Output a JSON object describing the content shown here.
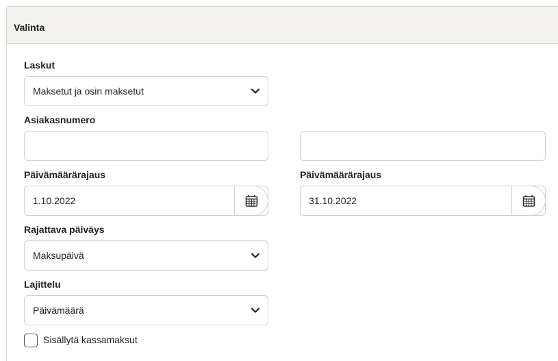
{
  "panel": {
    "title": "Valinta"
  },
  "invoices": {
    "label": "Laskut",
    "selected": "Maksetut ja osin maksetut",
    "icon": "chevron-down-icon"
  },
  "customer": {
    "label": "Asiakasnumero",
    "from_value": "",
    "to_value": ""
  },
  "date_from": {
    "label": "Päivämäärärajaus",
    "value": "1.10.2022",
    "icon": "calendar-icon"
  },
  "date_to": {
    "label": "Päivämäärärajaus",
    "value": "31.10.2022",
    "icon": "calendar-icon"
  },
  "date_type": {
    "label": "Rajattava päiväys",
    "selected": "Maksupäivä",
    "icon": "chevron-down-icon"
  },
  "sorting": {
    "label": "Lajittelu",
    "selected": "Päivämäärä",
    "icon": "chevron-down-icon"
  },
  "include_cash": {
    "label": "Sisällytä kassamaksut",
    "checked": false
  }
}
